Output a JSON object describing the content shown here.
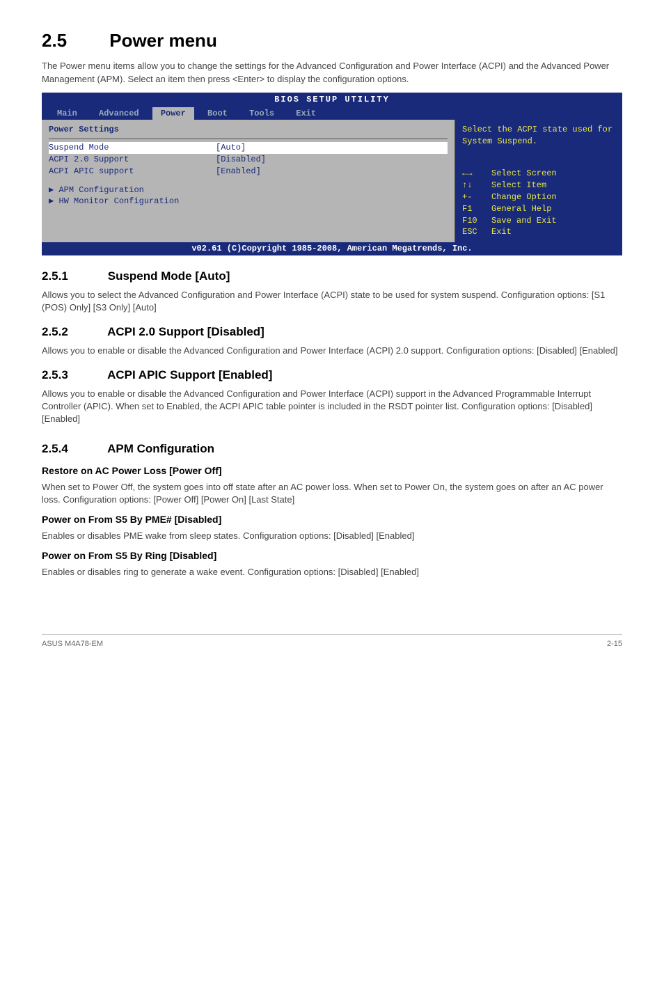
{
  "heading": {
    "num": "2.5",
    "title": "Power menu"
  },
  "intro": "The Power menu items allow you to change the settings for the Advanced Configuration and Power Interface (ACPI) and the Advanced Power Management (APM). Select an item then press <Enter> to display the configuration options.",
  "bios": {
    "top_title": "BIOS SETUP UTILITY",
    "tabs": {
      "main": "Main",
      "advanced": "Advanced",
      "power": "Power",
      "boot": "Boot",
      "tools": "Tools",
      "exit": "Exit"
    },
    "panel_title": "Power Settings",
    "rows": {
      "suspend_mode": {
        "label": "Suspend Mode",
        "val": "[Auto]"
      },
      "acpi20": {
        "label": "ACPI 2.0 Support",
        "val": "[Disabled]"
      },
      "acpi_apic": {
        "label": "ACPI APIC support",
        "val": "[Enabled]"
      }
    },
    "sub1": "APM Configuration",
    "sub2": "HW Monitor Configuration",
    "side_hint": "Select the ACPI state used for System Suspend.",
    "hints": {
      "select_screen": "Select Screen",
      "select_item": "Select Item",
      "change_option": "Change Option",
      "general_help": "General Help",
      "save_exit": "Save and Exit",
      "exit": "Exit",
      "k_arrows": "←→",
      "k_updown": "↑↓",
      "k_pm": "+-",
      "k_f1": "F1",
      "k_f10": "F10",
      "k_esc": "ESC"
    },
    "footer": "v02.61 (C)Copyright 1985-2008, American Megatrends, Inc."
  },
  "s251": {
    "num": "2.5.1",
    "title": "Suspend Mode [Auto]",
    "body": "Allows you to select the Advanced Configuration and Power Interface (ACPI) state to be used for system suspend. Configuration options: [S1 (POS) Only] [S3 Only] [Auto]"
  },
  "s252": {
    "num": "2.5.2",
    "title": "ACPI 2.0 Support [Disabled]",
    "body": "Allows you to enable or disable the Advanced Configuration and Power Interface (ACPI) 2.0 support. Configuration options: [Disabled] [Enabled]"
  },
  "s253": {
    "num": "2.5.3",
    "title": "ACPI APIC Support [Enabled]",
    "body": "Allows you to enable or disable the Advanced Configuration and Power Interface (ACPI) support in the Advanced Programmable Interrupt Controller (APIC). When set to Enabled, the ACPI APIC table pointer is included in the RSDT pointer list. Configuration options: [Disabled] [Enabled]"
  },
  "s254": {
    "num": "2.5.4",
    "title": "APM Configuration"
  },
  "opt1": {
    "title": "Restore on AC Power Loss [Power Off]",
    "body": "When set to Power Off, the system goes into off state after an AC power loss. When set to Power On, the system goes on after an AC power loss. Configuration options: [Power Off] [Power On] [Last State]"
  },
  "opt2": {
    "title": "Power on From S5 By PME# [Disabled]",
    "body": "Enables or disables PME wake from sleep states. Configuration options: [Disabled] [Enabled]"
  },
  "opt3": {
    "title": "Power on From S5 By Ring [Disabled]",
    "body": "Enables or disables ring to generate a wake event. Configuration options: [Disabled] [Enabled]"
  },
  "footer": {
    "product": "ASUS M4A78-EM",
    "page": "2-15"
  }
}
